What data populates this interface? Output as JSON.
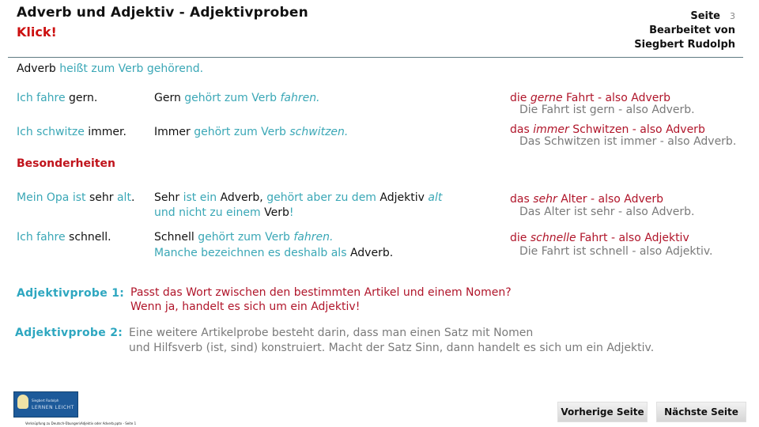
{
  "header": {
    "title": "Adverb und Adjektiv - Adjektivproben",
    "klick": "Klick!",
    "page_label": "Seite",
    "page_number": "3",
    "edited_by": "Bearbeitet von",
    "author": "Siegbert Rudolph"
  },
  "intro": {
    "part1": "Adverb",
    "part2": " heißt zum Verb gehörend."
  },
  "examples": [
    {
      "sentence": [
        {
          "text": "Ich fahre ",
          "style": "teal"
        },
        {
          "text": "gern.",
          "style": "dark"
        }
      ],
      "explanation": [
        {
          "text": "Gern ",
          "style": "dark"
        },
        {
          "text": "gehört zum Verb ",
          "style": "teal"
        },
        {
          "text": "fahren.",
          "style": "teal it"
        }
      ],
      "explanation2": [],
      "noun_phrase": [
        {
          "text": "die ",
          "style": "red"
        },
        {
          "text": "gerne",
          "style": "red it"
        },
        {
          "text": " Fahrt - also Adverb",
          "style": "red"
        }
      ],
      "check": "Die Fahrt ist gern - also Adverb."
    },
    {
      "sentence": [
        {
          "text": "Ich schwitze ",
          "style": "teal"
        },
        {
          "text": "immer.",
          "style": "dark"
        }
      ],
      "explanation": [
        {
          "text": "Immer ",
          "style": "dark"
        },
        {
          "text": "gehört zum Verb ",
          "style": "teal"
        },
        {
          "text": "schwitzen.",
          "style": "teal it"
        }
      ],
      "explanation2": [],
      "noun_phrase": [
        {
          "text": "das ",
          "style": "red"
        },
        {
          "text": "immer",
          "style": "red it"
        },
        {
          "text": " Schwitzen - also Adverb",
          "style": "red"
        }
      ],
      "check": "Das Schwitzen ist immer - also Adverb."
    }
  ],
  "special_heading": "Besonderheiten",
  "special": [
    {
      "sentence": [
        {
          "text": "Mein Opa ist ",
          "style": "teal"
        },
        {
          "text": "sehr ",
          "style": "dark"
        },
        {
          "text": "alt",
          "style": "teal"
        },
        {
          "text": ".",
          "style": "dark"
        }
      ],
      "explanation": [
        {
          "text": "Sehr ",
          "style": "dark"
        },
        {
          "text": "ist ein ",
          "style": "teal"
        },
        {
          "text": "Adverb, ",
          "style": "dark"
        },
        {
          "text": "gehört aber zu dem ",
          "style": "teal"
        },
        {
          "text": "Adjektiv ",
          "style": "dark"
        },
        {
          "text": "alt",
          "style": "teal it"
        }
      ],
      "explanation2": [
        {
          "text": "und nicht zu einem ",
          "style": "teal"
        },
        {
          "text": "Verb",
          "style": "dark"
        },
        {
          "text": "!",
          "style": "teal"
        }
      ],
      "noun_phrase": [
        {
          "text": "das ",
          "style": "red"
        },
        {
          "text": "sehr",
          "style": "red it"
        },
        {
          "text": " Alter - also Adverb",
          "style": "red"
        }
      ],
      "check": "Das Alter ist sehr - also Adverb."
    },
    {
      "sentence": [
        {
          "text": "Ich fahre ",
          "style": "teal"
        },
        {
          "text": "schnell.",
          "style": "dark"
        }
      ],
      "explanation": [
        {
          "text": "Schnell ",
          "style": "dark"
        },
        {
          "text": "gehört zum Verb ",
          "style": "teal"
        },
        {
          "text": "fahren.",
          "style": "teal it"
        }
      ],
      "explanation2": [
        {
          "text": "Manche bezeichnen es deshalb als ",
          "style": "teal"
        },
        {
          "text": "Adverb.",
          "style": "dark"
        }
      ],
      "noun_phrase": [
        {
          "text": "die ",
          "style": "red"
        },
        {
          "text": "schnelle",
          "style": "red it"
        },
        {
          "text": " Fahrt - also Adjektiv",
          "style": "red"
        }
      ],
      "check": "Die Fahrt ist schnell - also Adjektiv."
    }
  ],
  "probes": [
    {
      "label": "Adjektivprobe 1:",
      "line1": "Passt das Wort zwischen den bestimmten Artikel und einem Nomen?",
      "line2": "Wenn ja, handelt es sich um ein Adjektiv!"
    },
    {
      "label": "Adjektivprobe 2:",
      "line1": "Eine weitere Artikelprobe besteht darin, dass man einen Satz mit Nomen",
      "line2": "und Hilfsverb (ist, sind) konstruiert. Macht der Satz Sinn, dann handelt es sich um ein Adjektiv."
    }
  ],
  "logo": {
    "line1": "Siegbert Rudolph",
    "line2": "LERNEN LEICHT"
  },
  "footer_text": "Verknüpfung zu Deutsch-Übungen\\Adjektiv oder Adverb.pptx - Seite 1",
  "nav": {
    "prev": "Vorherige Seite",
    "next": "Nächste Seite"
  },
  "colors": {
    "teal": "#3aa7b6",
    "red": "#b0152a",
    "title_red": "#cc1010",
    "grey": "#7a7a7a",
    "rule": "#5f7a82"
  }
}
